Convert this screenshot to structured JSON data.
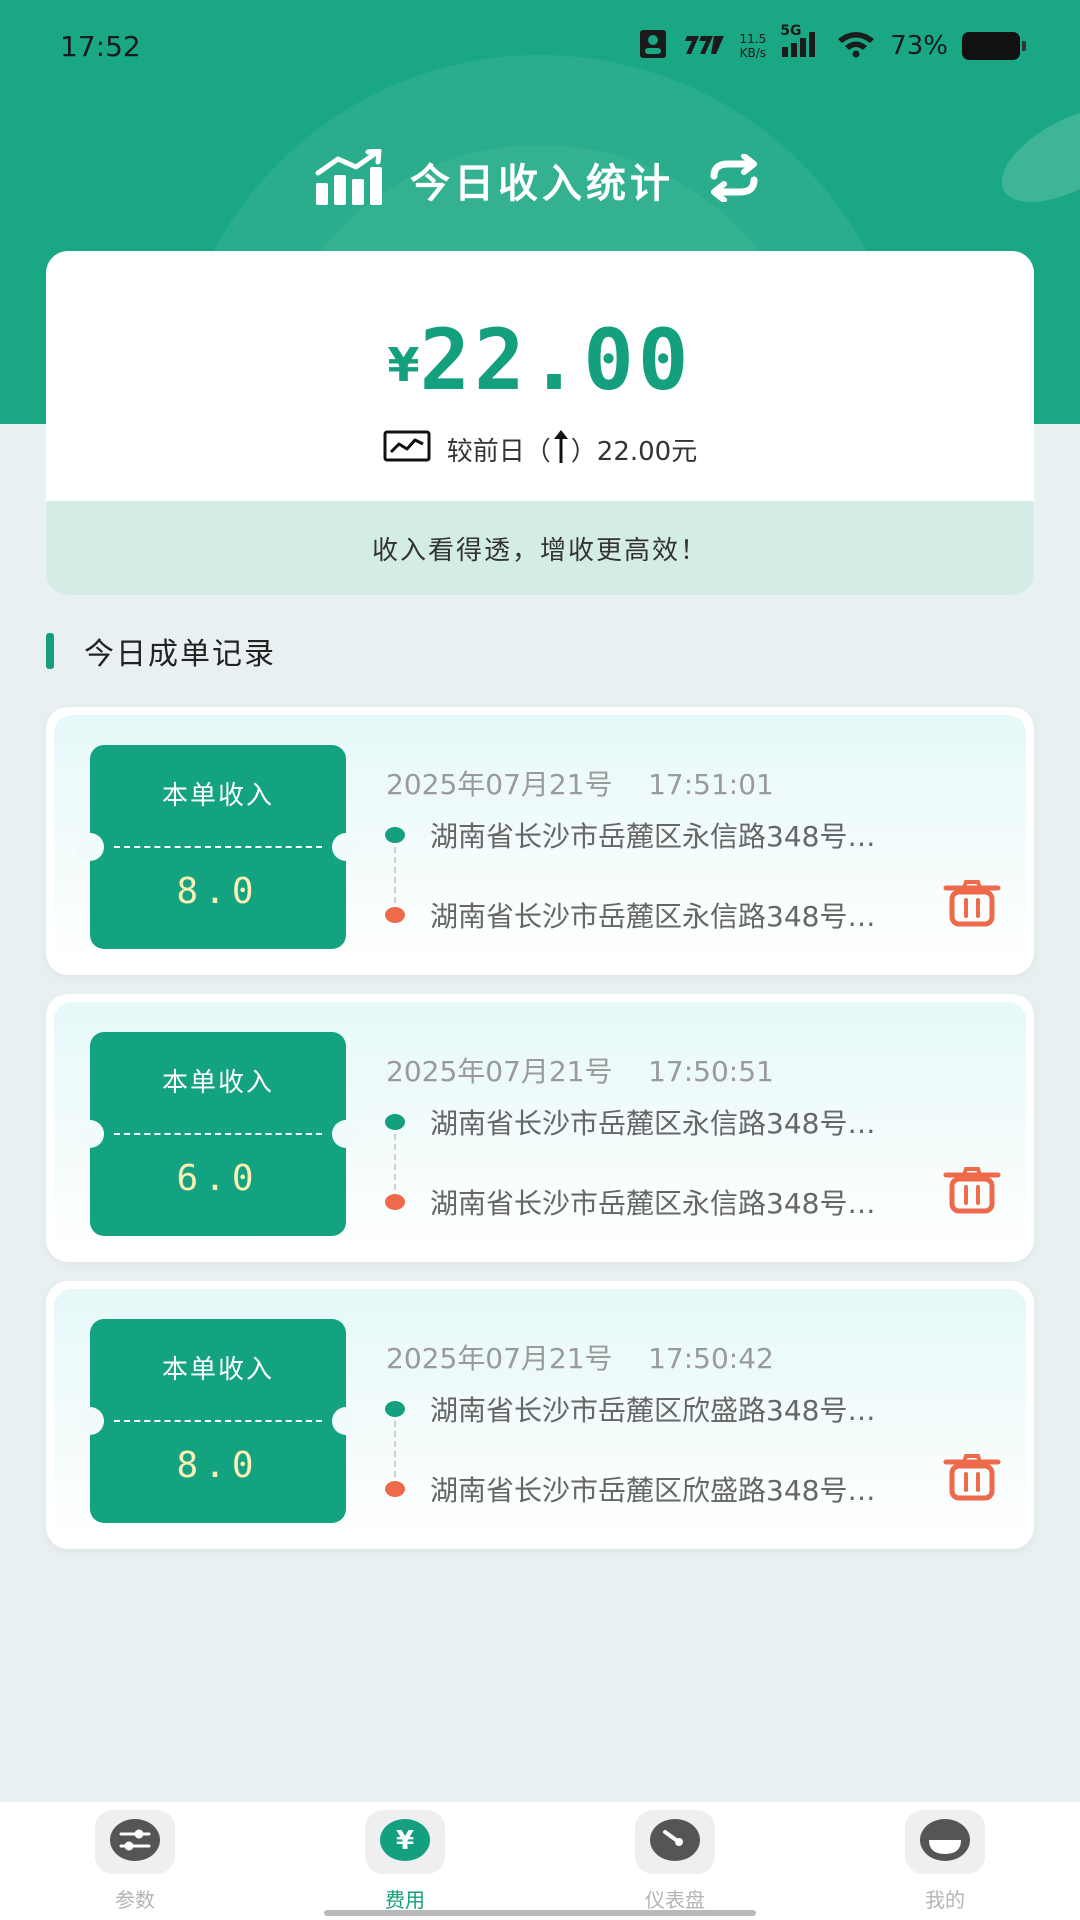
{
  "status_bar": {
    "time": "17:52",
    "net_speed_value": "11.5",
    "net_speed_unit": "KB/s",
    "network": "5G",
    "battery": "73%"
  },
  "header": {
    "title": "今日收入统计",
    "icons": [
      "bar-chart-icon",
      "refresh-icon"
    ]
  },
  "summary": {
    "currency": "¥",
    "amount": "22.00",
    "compare_label": "较前日（",
    "compare_value": "）22.00元",
    "slogan": "收入看得透，增收更高效！"
  },
  "section": {
    "title": "今日成单记录"
  },
  "records": [
    {
      "label": "本单收入",
      "income": "8.0",
      "datetime": "2025年07月21号    17:51:01",
      "start": "湖南省长沙市岳麓区永信路348号…",
      "end": "湖南省长沙市岳麓区永信路348号…"
    },
    {
      "label": "本单收入",
      "income": "6.0",
      "datetime": "2025年07月21号    17:50:51",
      "start": "湖南省长沙市岳麓区永信路348号…",
      "end": "湖南省长沙市岳麓区永信路348号…"
    },
    {
      "label": "本单收入",
      "income": "8.0",
      "datetime": "2025年07月21号    17:50:42",
      "start": "湖南省长沙市岳麓区欣盛路348号…",
      "end": "湖南省长沙市岳麓区欣盛路348号…"
    }
  ],
  "nav": {
    "items": [
      {
        "label": "参数",
        "icon": "sliders-icon",
        "active": false
      },
      {
        "label": "费用",
        "icon": "yen-icon",
        "active": true
      },
      {
        "label": "仪表盘",
        "icon": "gauge-icon",
        "active": false
      },
      {
        "label": "我的",
        "icon": "profile-icon",
        "active": false
      }
    ]
  },
  "colors": {
    "primary": "#14a07f",
    "header_bg": "#1aa784",
    "accent_red": "#ee6a4a",
    "income_text": "#fcefb6"
  }
}
